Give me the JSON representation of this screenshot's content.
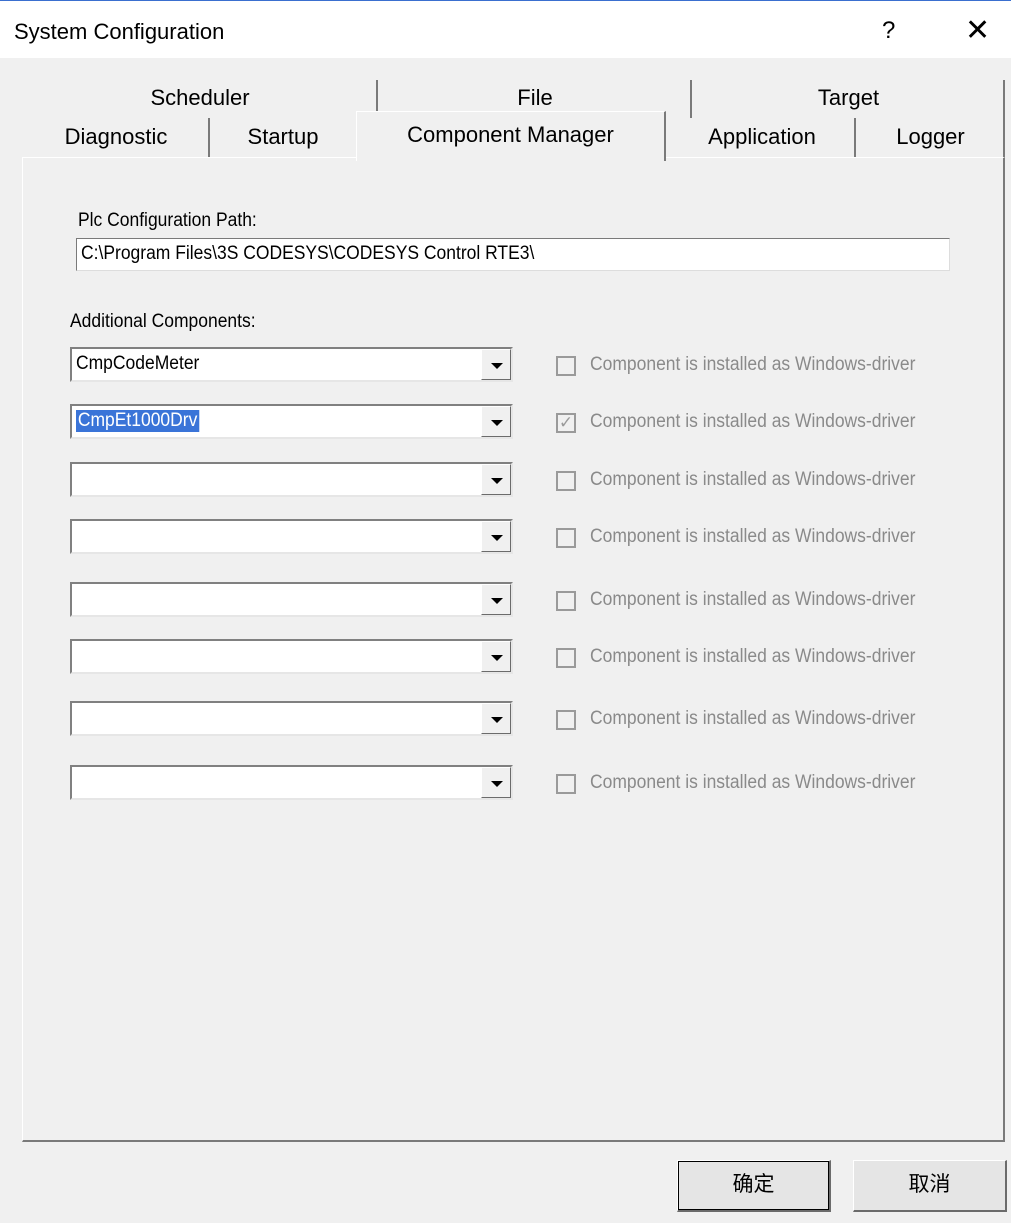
{
  "window": {
    "title": "System Configuration",
    "help_label": "?",
    "close_label": "✕"
  },
  "tabs": {
    "row1": [
      "Scheduler",
      "File",
      "Target"
    ],
    "row2": [
      "Diagnostic",
      "Startup",
      "Component Manager",
      "Application",
      "Logger"
    ],
    "active": "Component Manager"
  },
  "main": {
    "path_label": "Plc Configuration Path:",
    "path_value": "C:\\Program Files\\3S CODESYS\\CODESYS Control RTE3\\",
    "components_label": "Additional Components:",
    "components": [
      {
        "value": "CmpCodeMeter",
        "selected": false,
        "driver_checked": false,
        "driver_label": "Component is installed as Windows-driver"
      },
      {
        "value": "CmpEt1000Drv",
        "selected": true,
        "driver_checked": true,
        "driver_label": "Component is installed as Windows-driver"
      },
      {
        "value": "",
        "selected": false,
        "driver_checked": false,
        "driver_label": "Component is installed as Windows-driver"
      },
      {
        "value": "",
        "selected": false,
        "driver_checked": false,
        "driver_label": "Component is installed as Windows-driver"
      },
      {
        "value": "",
        "selected": false,
        "driver_checked": false,
        "driver_label": "Component is installed as Windows-driver"
      },
      {
        "value": "",
        "selected": false,
        "driver_checked": false,
        "driver_label": "Component is installed as Windows-driver"
      },
      {
        "value": "",
        "selected": false,
        "driver_checked": false,
        "driver_label": "Component is installed as Windows-driver"
      },
      {
        "value": "",
        "selected": false,
        "driver_checked": false,
        "driver_label": "Component is installed as Windows-driver"
      }
    ]
  },
  "footer": {
    "ok_label": "确定",
    "cancel_label": "取消"
  }
}
